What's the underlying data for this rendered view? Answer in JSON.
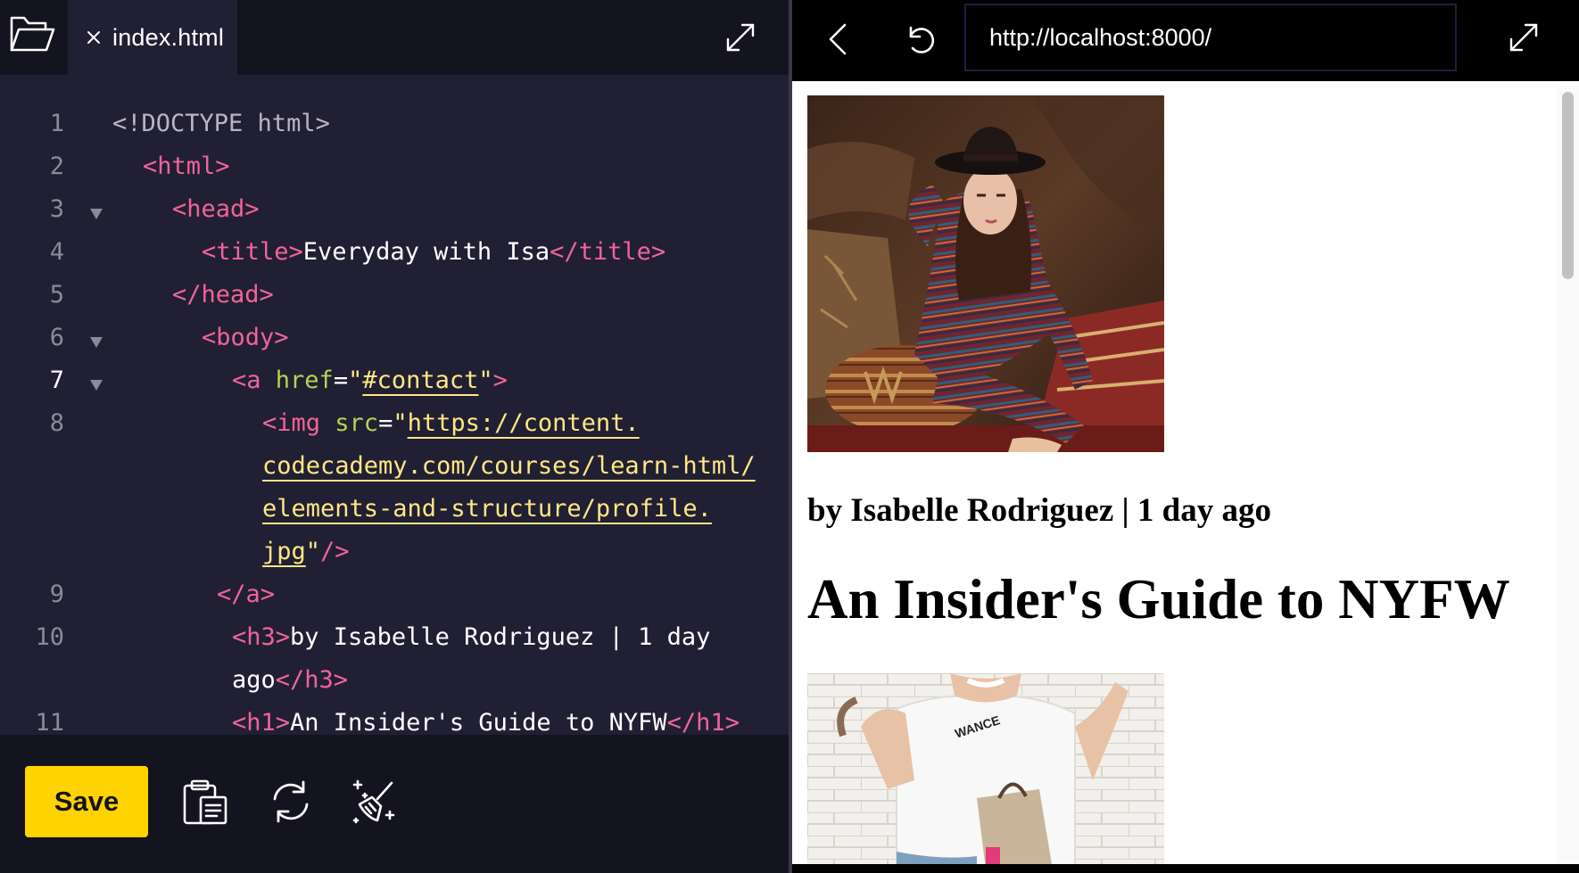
{
  "editor": {
    "file_tab": {
      "label": "index.html"
    },
    "gutter": {
      "line_numbers": [
        "1",
        "2",
        "3",
        "4",
        "5",
        "6",
        "7",
        "8",
        "9",
        "10",
        "11"
      ]
    },
    "code": {
      "l1": {
        "text": "<!DOCTYPE html>"
      },
      "l2": {
        "open": "<html>"
      },
      "l3": {
        "open": "<head>"
      },
      "l4": {
        "open": "<title>",
        "text": "Everyday with Isa",
        "close": "</title>"
      },
      "l5": {
        "close": "</head>"
      },
      "l6": {
        "open": "<body>"
      },
      "l7": {
        "tag_start": "<a ",
        "attr": "href",
        "eq": "=",
        "quote_open": "\"",
        "value": "#contact",
        "quote_close": "\"",
        "tag_end": ">"
      },
      "l8": {
        "tag_start": "<img ",
        "attr": "src",
        "eq": "=",
        "quote_open": "\"",
        "value_1": "https://content.",
        "value_2": "codecademy.com/courses/learn-html/",
        "value_3": "elements-and-structure/profile.",
        "value_4": "jpg",
        "quote_close": "\"",
        "tag_end": "/>"
      },
      "l9": {
        "close": "</a>"
      },
      "l10": {
        "open": "<h3>",
        "text_1": "by Isabelle Rodriguez | 1 day",
        "text_2": "ago",
        "close": "</h3>"
      },
      "l11": {
        "open": "<h1>",
        "text": "An Insider's Guide to NYFW",
        "close": "</h1>"
      }
    },
    "toolbar": {
      "save_label": "Save"
    }
  },
  "browser": {
    "url": "http://localhost:8000/",
    "preview": {
      "h3": "by Isabelle Rodriguez | 1 day ago",
      "h1": "An Insider's Guide to NYFW",
      "shirt_text": "WANCE"
    }
  },
  "icons": {
    "folder": "folder-open-icon",
    "tab_close": "close-icon",
    "expand": "expand-icon",
    "fold": "caret-down-icon",
    "copy": "clipboard-icon",
    "reset": "refresh-icon",
    "format": "magic-broom-icon",
    "back": "chevron-left-icon",
    "reload": "reload-icon"
  },
  "colors": {
    "editor_bg": "#211f33",
    "editor_chrome": "#141320",
    "tag": "#f0649a",
    "attribute": "#b4d353",
    "string": "#ffe785",
    "save_button": "#ffd300",
    "preview_bg": "#ffffff"
  }
}
